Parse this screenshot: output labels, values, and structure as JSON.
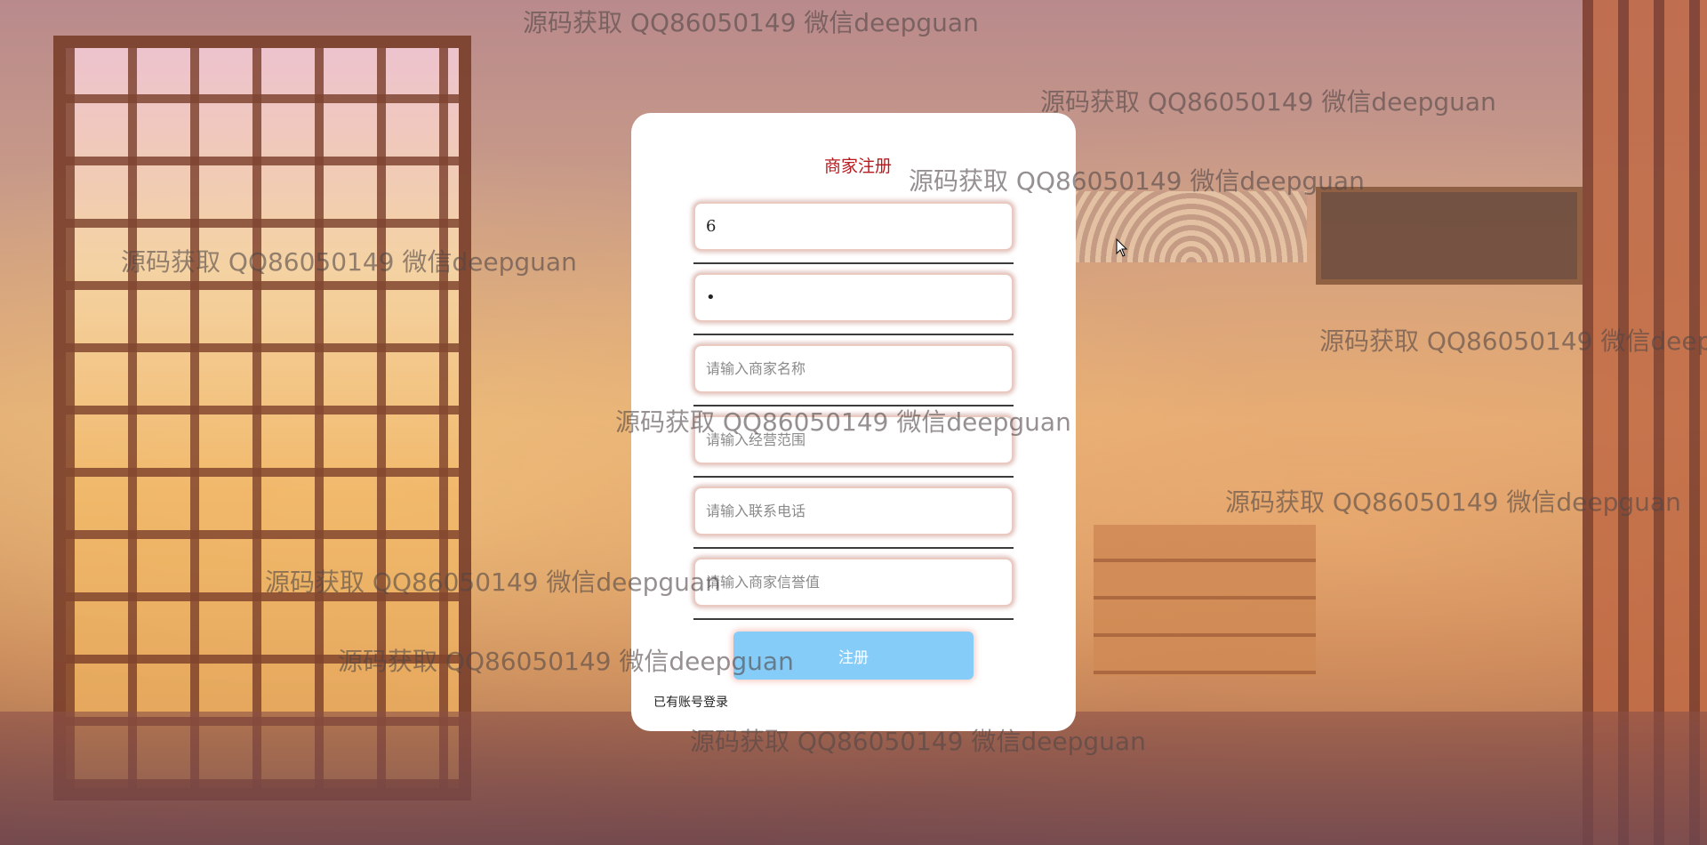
{
  "register_form": {
    "title": "商家注册",
    "fields": [
      {
        "name": "account",
        "value": "6",
        "placeholder": "",
        "type": "text"
      },
      {
        "name": "password",
        "value": "•",
        "placeholder": "",
        "type": "password"
      },
      {
        "name": "merchant_name",
        "value": "",
        "placeholder": "请输入商家名称",
        "type": "text"
      },
      {
        "name": "business_scope",
        "value": "",
        "placeholder": "请输入经营范围",
        "type": "text"
      },
      {
        "name": "contact_phone",
        "value": "",
        "placeholder": "请输入联系电话",
        "type": "text"
      },
      {
        "name": "credit_value",
        "value": "",
        "placeholder": "请输入商家信誉值",
        "type": "text"
      }
    ],
    "submit_label": "注册",
    "login_link_label": "已有账号登录"
  },
  "watermark_text": "源码获取 QQ86050149 微信deepguan",
  "colors": {
    "title": "#b8191c",
    "submit_bg": "#86ccf8",
    "card_bg": "#ffffff"
  }
}
